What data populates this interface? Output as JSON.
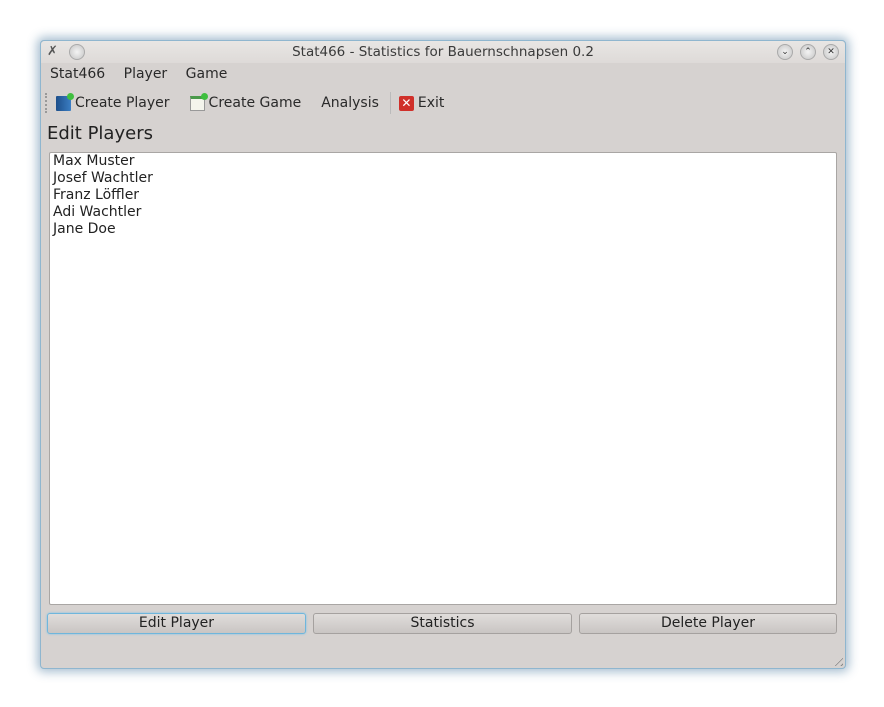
{
  "window": {
    "title": "Stat466 - Statistics for Bauernschnapsen 0.2"
  },
  "menu": [
    "Stat466",
    "Player",
    "Game"
  ],
  "toolbar": {
    "create_player": "Create Player",
    "create_game": "Create Game",
    "analysis": "Analysis",
    "exit": "Exit"
  },
  "heading": "Edit Players",
  "players": [
    "Max Muster",
    "Josef Wachtler",
    "Franz Löffler",
    "Adi Wachtler",
    "Jane Doe"
  ],
  "buttons": {
    "edit": "Edit Player",
    "statistics": "Statistics",
    "delete": "Delete Player"
  }
}
